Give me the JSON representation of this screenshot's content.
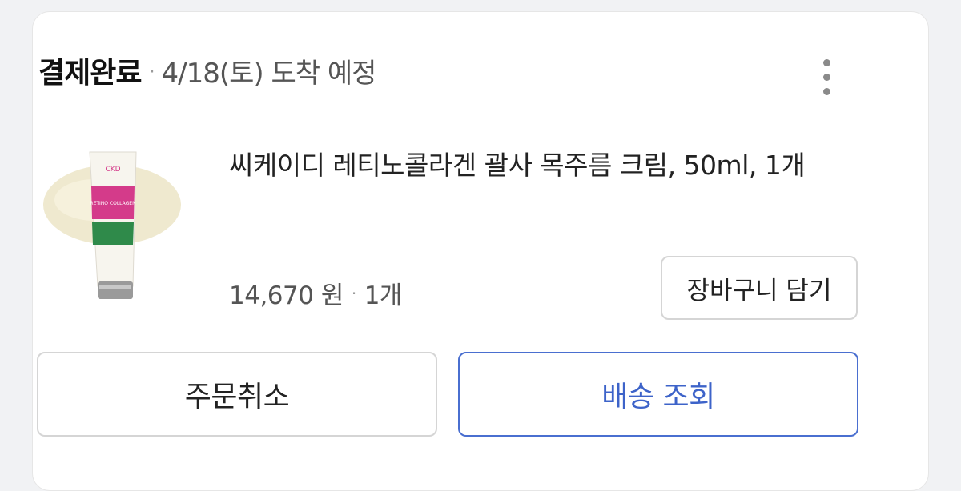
{
  "order": {
    "status": "결제완료",
    "separator": "·",
    "arrival": "4/18(토) 도착 예정"
  },
  "product": {
    "name": "씨케이디 레티노콜라겐 괄사 목주름 크림, 50ml, 1개",
    "price": "14,670 원",
    "separator": "·",
    "quantity": "1개",
    "image_brand": "CKD",
    "image_label": "RETINO COLLAGEN"
  },
  "buttons": {
    "cart": "장바구니 담기",
    "cancel": "주문취소",
    "track": "배송 조회"
  },
  "colors": {
    "accent": "#3d63c9",
    "accent_border": "#4a6fd0",
    "tube_pink": "#d43b8a",
    "tube_green": "#2f8a4a",
    "cream": "#efe9cf"
  },
  "icons": {
    "more": "more-vertical-icon"
  }
}
